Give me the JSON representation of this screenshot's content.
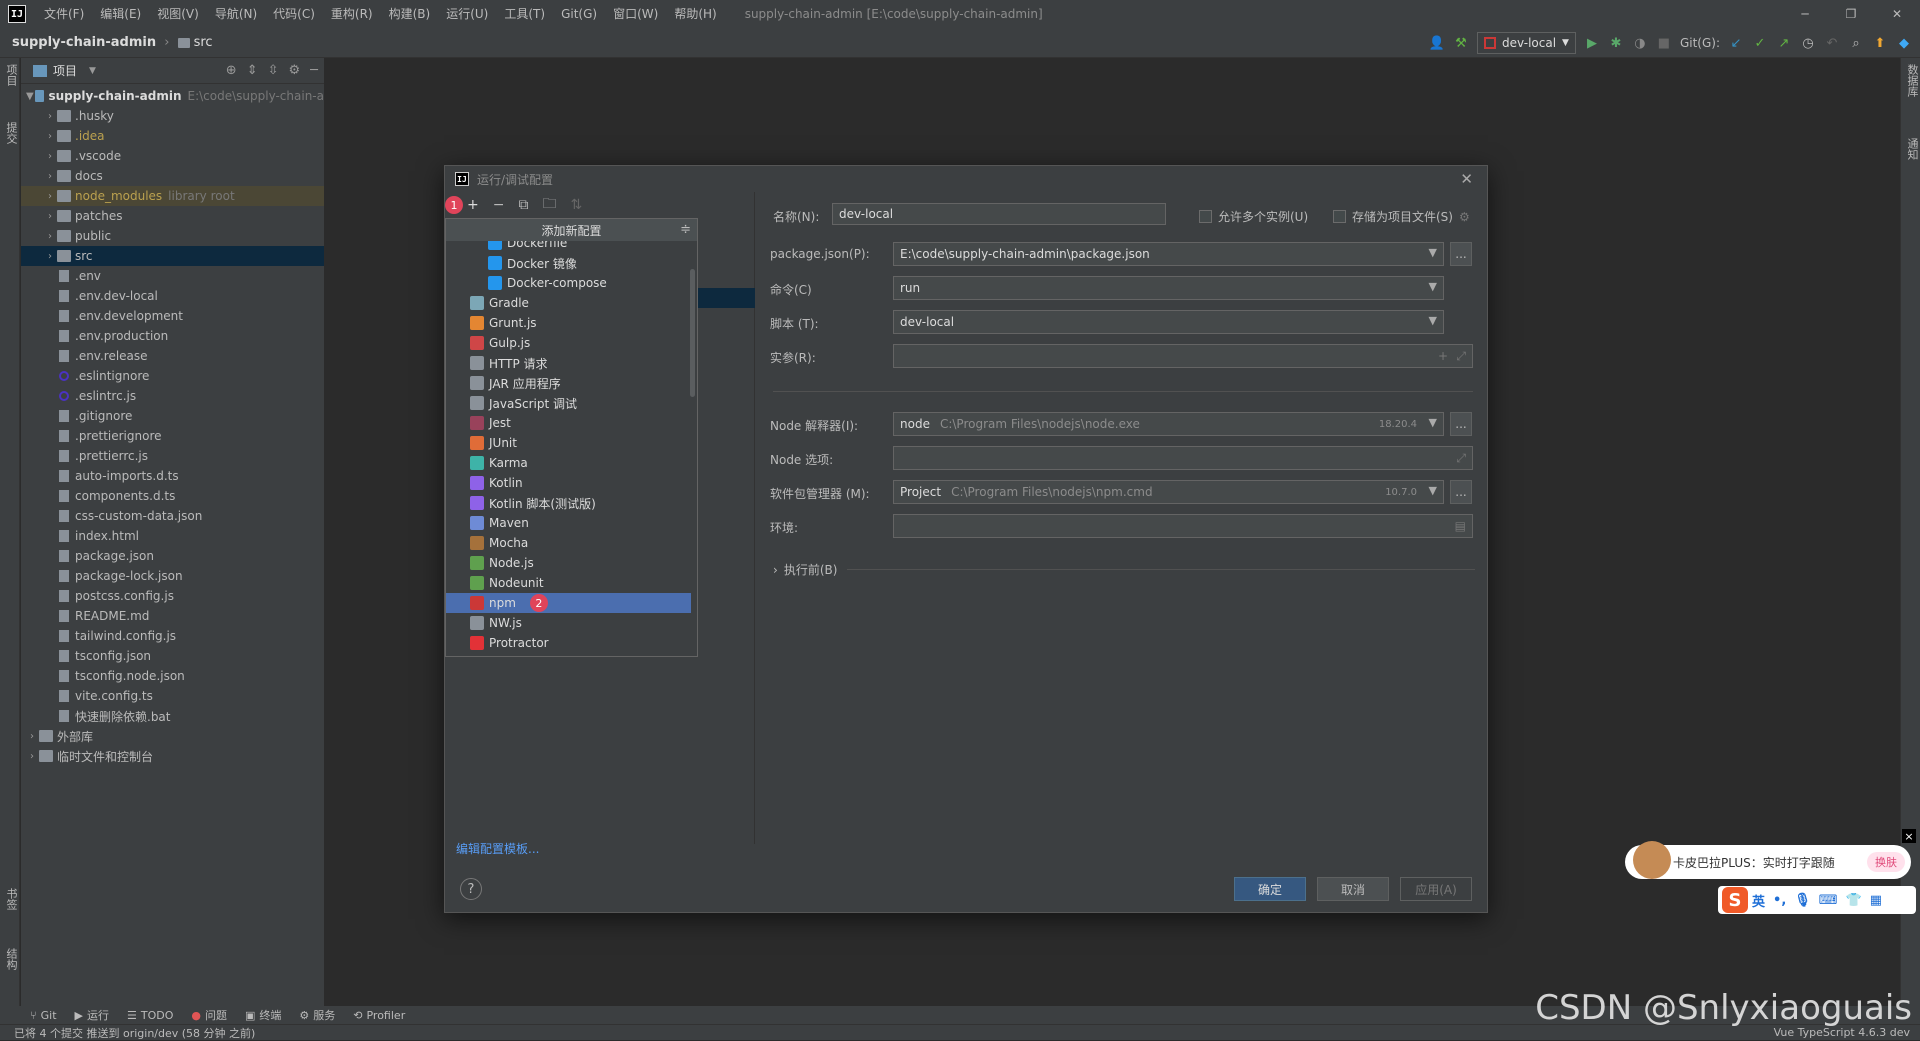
{
  "titlebar": {
    "menu": [
      "文件(F)",
      "编辑(E)",
      "视图(V)",
      "导航(N)",
      "代码(C)",
      "重构(R)",
      "构建(B)",
      "运行(U)",
      "工具(T)",
      "Git(G)",
      "窗口(W)",
      "帮助(H)"
    ],
    "title": "supply-chain-admin [E:\\code\\supply-chain-admin]"
  },
  "navbar": {
    "project": "supply-chain-admin",
    "folder": "src",
    "run_config": "dev-local",
    "git_label": "Git(G):"
  },
  "leftstrip": {
    "project_tab": "项目",
    "commit_tab": "提交",
    "bookmarks_tab": "书签",
    "structure_tab": "结构"
  },
  "rightstrip": {
    "database_tab": "数据库",
    "notifications_tab": "通知"
  },
  "project_panel": {
    "header": "项目",
    "root": {
      "name": "supply-chain-admin",
      "path": "E:\\code\\supply-chain-a"
    },
    "items": [
      {
        "name": ".husky",
        "type": "folder"
      },
      {
        "name": ".idea",
        "type": "folder",
        "hint": ""
      },
      {
        "name": ".vscode",
        "type": "folder"
      },
      {
        "name": "docs",
        "type": "folder"
      },
      {
        "name": "node_modules",
        "type": "folder",
        "hint": "library root"
      },
      {
        "name": "patches",
        "type": "folder"
      },
      {
        "name": "public",
        "type": "folder"
      },
      {
        "name": "src",
        "type": "folder"
      },
      {
        "name": ".env",
        "type": "file"
      },
      {
        "name": ".env.dev-local",
        "type": "file"
      },
      {
        "name": ".env.development",
        "type": "file"
      },
      {
        "name": ".env.production",
        "type": "file"
      },
      {
        "name": ".env.release",
        "type": "file"
      },
      {
        "name": ".eslintignore",
        "type": "eslint"
      },
      {
        "name": ".eslintrc.js",
        "type": "eslint"
      },
      {
        "name": ".gitignore",
        "type": "file"
      },
      {
        "name": ".prettierignore",
        "type": "file"
      },
      {
        "name": ".prettierrc.js",
        "type": "file"
      },
      {
        "name": "auto-imports.d.ts",
        "type": "file"
      },
      {
        "name": "components.d.ts",
        "type": "file"
      },
      {
        "name": "css-custom-data.json",
        "type": "file"
      },
      {
        "name": "index.html",
        "type": "file"
      },
      {
        "name": "package.json",
        "type": "file"
      },
      {
        "name": "package-lock.json",
        "type": "file"
      },
      {
        "name": "postcss.config.js",
        "type": "file"
      },
      {
        "name": "README.md",
        "type": "file"
      },
      {
        "name": "tailwind.config.js",
        "type": "file"
      },
      {
        "name": "tsconfig.json",
        "type": "file"
      },
      {
        "name": "tsconfig.node.json",
        "type": "file"
      },
      {
        "name": "vite.config.ts",
        "type": "file"
      },
      {
        "name": "快速删除依赖.bat",
        "type": "file"
      }
    ],
    "external_libs": "外部库",
    "scratches": "临时文件和控制台"
  },
  "dialog": {
    "title": "运行/调试配置",
    "badge1": "1",
    "badge2": "2",
    "edit_templates": "编辑配置模板...",
    "popup": {
      "header": "添加新配置",
      "items": [
        {
          "label": "Dockerfile",
          "sub": true,
          "color": "#2496ed"
        },
        {
          "label": "Docker 镜像",
          "sub": true,
          "color": "#2496ed"
        },
        {
          "label": "Docker-compose",
          "sub": true,
          "color": "#2496ed"
        },
        {
          "label": "Gradle",
          "color": "#7ca7b6"
        },
        {
          "label": "Grunt.js",
          "color": "#e48632"
        },
        {
          "label": "Gulp.js",
          "color": "#cf4647"
        },
        {
          "label": "HTTP 请求",
          "color": "#8a9199"
        },
        {
          "label": "JAR 应用程序",
          "color": "#8a9199"
        },
        {
          "label": "JavaScript 调试",
          "color": "#8a9199"
        },
        {
          "label": "Jest",
          "color": "#99425b"
        },
        {
          "label": "JUnit",
          "color": "#e06c38"
        },
        {
          "label": "Karma",
          "color": "#3eb3a8"
        },
        {
          "label": "Kotlin",
          "color": "#8e62e8"
        },
        {
          "label": "Kotlin 脚本(测试版)",
          "color": "#8e62e8"
        },
        {
          "label": "Maven",
          "color": "#6e8bd6"
        },
        {
          "label": "Mocha",
          "color": "#a5713b"
        },
        {
          "label": "Node.js",
          "color": "#5fa04e"
        },
        {
          "label": "Nodeunit",
          "color": "#5fa04e"
        },
        {
          "label": "npm",
          "color": "#cb3837",
          "selected": true
        },
        {
          "label": "NW.js",
          "color": "#8a9199"
        },
        {
          "label": "Protractor",
          "color": "#e23237"
        }
      ]
    },
    "form": {
      "name_label": "名称(N):",
      "name_value": "dev-local",
      "allow_parallel": "允许多个实例(U)",
      "store_as_file": "存储为项目文件(S)",
      "package_json_label": "package.json(P):",
      "package_json_value": "E:\\code\\supply-chain-admin\\package.json",
      "command_label": "命令(C)",
      "command_value": "run",
      "scripts_label": "脚本 (T):",
      "scripts_value": "dev-local",
      "arguments_label": "实参(R):",
      "node_interpreter_label": "Node 解释器(I):",
      "node_interpreter_kind": "node",
      "node_interpreter_path": "C:\\Program Files\\nodejs\\node.exe",
      "node_version": "18.20.4",
      "node_options_label": "Node 选项:",
      "package_manager_label": "软件包管理器 (M):",
      "package_manager_kind": "Project",
      "package_manager_path": "C:\\Program Files\\nodejs\\npm.cmd",
      "package_manager_version": "10.7.0",
      "env_label": "环境:",
      "before_launch": "执行前(B)",
      "dots": "..."
    },
    "buttons": {
      "ok": "确定",
      "cancel": "取消",
      "apply": "应用(A)",
      "help": "?"
    }
  },
  "bottombar": [
    "Git",
    "运行",
    "TODO",
    "问题",
    "终端",
    "服务",
    "Profiler"
  ],
  "statusbar": {
    "message": "已将 4 个提交 推送到 origin/dev (58 分钟 之前)",
    "right": "Vue TypeScript 4.6.3    dev"
  },
  "ime": {
    "bubble_text": "卡皮巴拉PLUS：实时打字跟随",
    "skin_btn": "换肤",
    "mode": "英",
    "close": "×"
  },
  "watermark": "CSDN @Snlyxiaoguais"
}
